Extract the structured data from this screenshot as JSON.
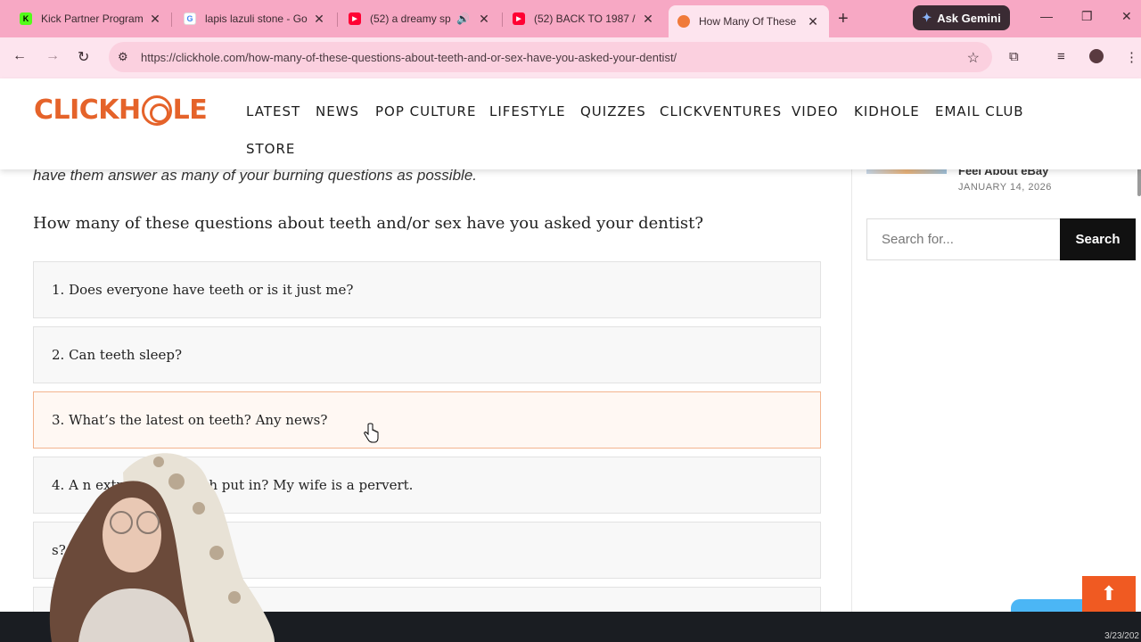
{
  "browser": {
    "tabs": [
      {
        "title": "Kick Partner Program",
        "favicon_color": "#53fc18",
        "favicon_glyph": "K"
      },
      {
        "title": "lapis lazuli stone - Go",
        "favicon_color": "#ffffff",
        "favicon_glyph": "G"
      },
      {
        "title": "(52) a dreamy sp",
        "favicon_color": "#ff0033",
        "favicon_glyph": "▶"
      },
      {
        "title": "(52) BACK TO 1987 /",
        "favicon_color": "#ff0033",
        "favicon_glyph": "▶"
      },
      {
        "title": "How Many Of These",
        "favicon_color": "#f07a3a",
        "favicon_glyph": ""
      }
    ],
    "new_tab": "+",
    "gemini_label": "Ask Gemini",
    "url": "https://clickhole.com/how-many-of-these-questions-about-teeth-and-or-sex-have-you-asked-your-dentist/",
    "accent_color": "#f7a8c4"
  },
  "site": {
    "logo": "CLICKHOLE",
    "nav": [
      "LATEST",
      "NEWS",
      "POP CULTURE",
      "LIFESTYLE",
      "QUIZZES",
      "CLICKVENTURES",
      "VIDEO",
      "KIDHOLE",
      "EMAIL CLUB",
      "STORE"
    ],
    "brand_color": "#e5632a"
  },
  "article": {
    "intro": "have them answer as many of your burning questions as possible.",
    "heading": "How many of these questions about teeth and/or sex have you asked your dentist?",
    "questions": [
      "1. Does everyone have teeth or is it just me?",
      "2. Can teeth sleep?",
      "3. What’s the latest on teeth? Any news?",
      "4. A                  n extra row of teeth put in? My wife is a pervert.",
      "                              s?"
    ]
  },
  "sidebar": {
    "post_title": "Feel About eBay",
    "post_date": "JANUARY 14, 2026",
    "search_placeholder": "Search for...",
    "search_button": "Search"
  },
  "taskbar": {
    "date": "3/23/202"
  }
}
